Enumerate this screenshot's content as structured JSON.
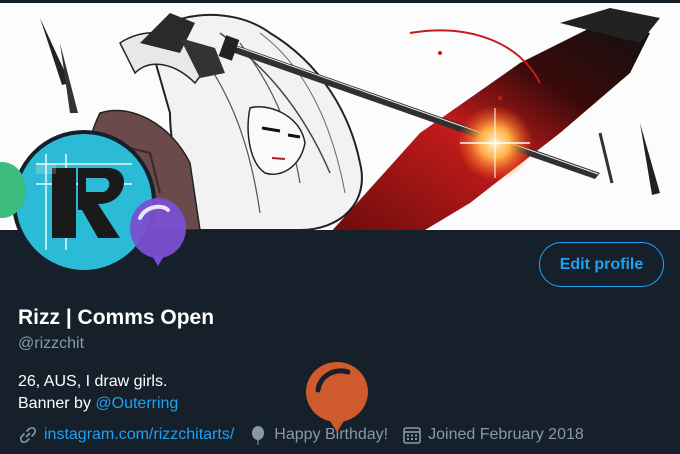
{
  "profile": {
    "display_name": "Rizz | Comms Open",
    "handle": "@rizzchit",
    "bio_line1": "26, AUS, I draw girls.",
    "bio_line2_prefix": "Banner by ",
    "bio_mention": "@Outerring"
  },
  "actions": {
    "edit_profile_label": "Edit profile"
  },
  "meta": {
    "website": "instagram.com/rizzchitarts/",
    "birthday": "Happy Birthday!",
    "joined": "Joined February 2018"
  },
  "icons": {
    "website": "link-icon",
    "birthday": "balloon-icon",
    "joined": "calendar-icon"
  },
  "colors": {
    "background": "#15202b",
    "accent": "#1da1f2",
    "muted": "#8899a6",
    "avatar_bg": "#2bbbd6",
    "balloon_orange": "#cf5a2b",
    "balloon_purple": "#7a4fd1"
  }
}
